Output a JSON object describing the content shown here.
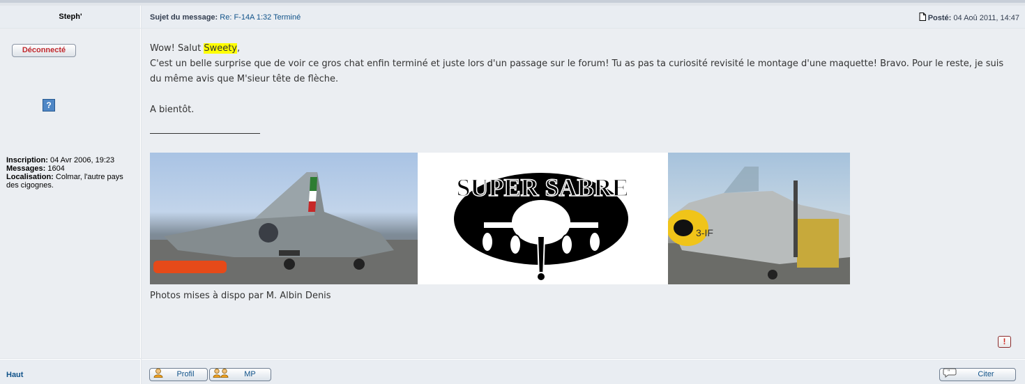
{
  "header": {
    "author_name": "Steph'",
    "subject_label": "Sujet du message:",
    "subject_value": "Re: F-14A 1:32 Terminé",
    "posted_label": "Posté:",
    "posted_value": "04 Aoû 2011, 14:47"
  },
  "profile": {
    "status_label": "Déconnecté",
    "help_glyph": "?",
    "inscription_label": "Inscription:",
    "inscription_value": "04 Avr 2006, 19:23",
    "messages_label": "Messages:",
    "messages_value": "1604",
    "location_label": "Localisation:",
    "location_value": "Colmar, l'autre pays des cigognes."
  },
  "post": {
    "greeting_before": "Wow! Salut ",
    "greeting_name": "Sweety",
    "greeting_after": ",",
    "paragraph_1": "C'est un belle surprise que de voir ce gros chat enfin terminé et juste lors d'un passage sur le forum! Tu as pas ta curiosité revisité le montage d'une maquette! Bravo. Pour le reste, je suis du même avis que M'sieur tête de flèche.",
    "paragraph_2": "A bientôt.",
    "signature_logo_text": "SUPER SABRE",
    "signature_caption": "Photos mises à dispo par M. Albin Denis",
    "report_glyph": "!"
  },
  "footer": {
    "top_link": "Haut",
    "profile_button": "Profil",
    "pm_button": "MP",
    "quote_button": "Citer"
  },
  "colors": {
    "link": "#105289",
    "offline": "#c0282d",
    "highlight": "#ffff00",
    "row_bg": "#ebeef2"
  }
}
